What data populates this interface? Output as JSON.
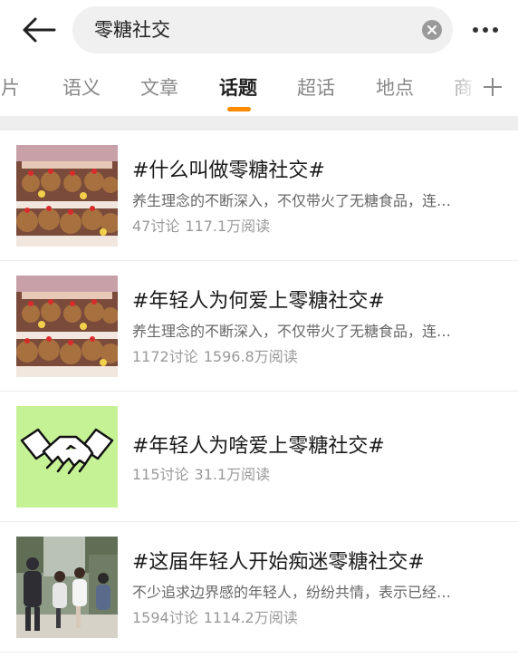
{
  "search": {
    "query": "零糖社交"
  },
  "icons": {
    "back": "arrow-left-icon",
    "clear": "clear-circle-icon",
    "more": "more-horizontal-icon",
    "add_tab": "plus-icon"
  },
  "tabs": [
    {
      "label": "图片",
      "active": false
    },
    {
      "label": "语义",
      "active": false
    },
    {
      "label": "文章",
      "active": false
    },
    {
      "label": "话题",
      "active": true
    },
    {
      "label": "超话",
      "active": false
    },
    {
      "label": "地点",
      "active": false
    },
    {
      "label": "商",
      "active": false
    }
  ],
  "topics": [
    {
      "title": "#什么叫做零糖社交#",
      "desc": "养生理念的不断深入，不仅带火了无糖食品，连…",
      "discussions": "47讨论",
      "reads": "117.1万阅读"
    },
    {
      "title": "#年轻人为何爱上零糖社交#",
      "desc": "养生理念的不断深入，不仅带火了无糖食品，连…",
      "discussions": "1172讨论",
      "reads": "1596.8万阅读"
    },
    {
      "title": "#年轻人为啥爱上零糖社交#",
      "desc": "",
      "discussions": "115讨论",
      "reads": "31.1万阅读"
    },
    {
      "title": "#这届年轻人开始痴迷零糖社交#",
      "desc": "不少追求边界感的年轻人，纷纷共情，表示已经…",
      "discussions": "1594讨论",
      "reads": "1114.2万阅读"
    }
  ],
  "colors": {
    "accent": "#ff8a00",
    "divider_band": "#eeeeee",
    "handshake_bg": "#c6f296"
  }
}
